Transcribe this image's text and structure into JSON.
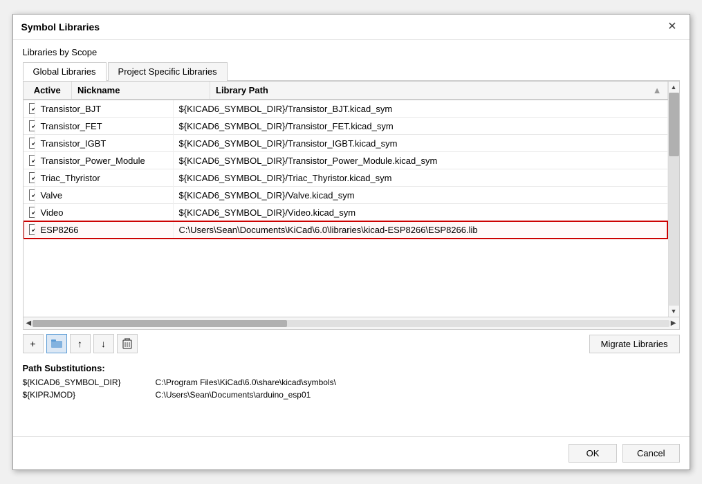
{
  "dialog": {
    "title": "Symbol Libraries",
    "close_label": "✕"
  },
  "scope_label": "Libraries by Scope",
  "tabs": [
    {
      "id": "global",
      "label": "Global Libraries",
      "active": true
    },
    {
      "id": "project",
      "label": "Project Specific Libraries",
      "active": false
    }
  ],
  "table": {
    "columns": [
      {
        "id": "active",
        "label": "Active"
      },
      {
        "id": "nickname",
        "label": "Nickname"
      },
      {
        "id": "library_path",
        "label": "Library Path"
      }
    ],
    "rows": [
      {
        "active": true,
        "nickname": "Transistor_BJT",
        "path": "${KICAD6_SYMBOL_DIR}/Transistor_BJT.kicad_sym",
        "selected": false
      },
      {
        "active": true,
        "nickname": "Transistor_FET",
        "path": "${KICAD6_SYMBOL_DIR}/Transistor_FET.kicad_sym",
        "selected": false
      },
      {
        "active": true,
        "nickname": "Transistor_IGBT",
        "path": "${KICAD6_SYMBOL_DIR}/Transistor_IGBT.kicad_sym",
        "selected": false
      },
      {
        "active": true,
        "nickname": "Transistor_Power_Module",
        "path": "${KICAD6_SYMBOL_DIR}/Transistor_Power_Module.kicad_sym",
        "selected": false
      },
      {
        "active": true,
        "nickname": "Triac_Thyristor",
        "path": "${KICAD6_SYMBOL_DIR}/Triac_Thyristor.kicad_sym",
        "selected": false
      },
      {
        "active": true,
        "nickname": "Valve",
        "path": "${KICAD6_SYMBOL_DIR}/Valve.kicad_sym",
        "selected": false
      },
      {
        "active": true,
        "nickname": "Video",
        "path": "${KICAD6_SYMBOL_DIR}/Video.kicad_sym",
        "selected": false
      },
      {
        "active": true,
        "nickname": "ESP8266",
        "path": "C:\\Users\\Sean\\Documents\\KiCad\\6.0\\libraries\\kicad-ESP8266\\ESP8266.lib",
        "selected": true
      }
    ]
  },
  "toolbar": {
    "add_label": "+",
    "folder_label": "📁",
    "up_label": "↑",
    "down_label": "↓",
    "delete_label": "🗑",
    "migrate_label": "Migrate Libraries"
  },
  "path_substitutions": {
    "title": "Path Substitutions:",
    "entries": [
      {
        "key": "${KICAD6_SYMBOL_DIR}",
        "value": "C:\\Program Files\\KiCad\\6.0\\share\\kicad\\symbols\\"
      },
      {
        "key": "${KIPRJMOD}",
        "value": "C:\\Users\\Sean\\Documents\\arduino_esp01"
      }
    ]
  },
  "footer": {
    "ok_label": "OK",
    "cancel_label": "Cancel"
  }
}
